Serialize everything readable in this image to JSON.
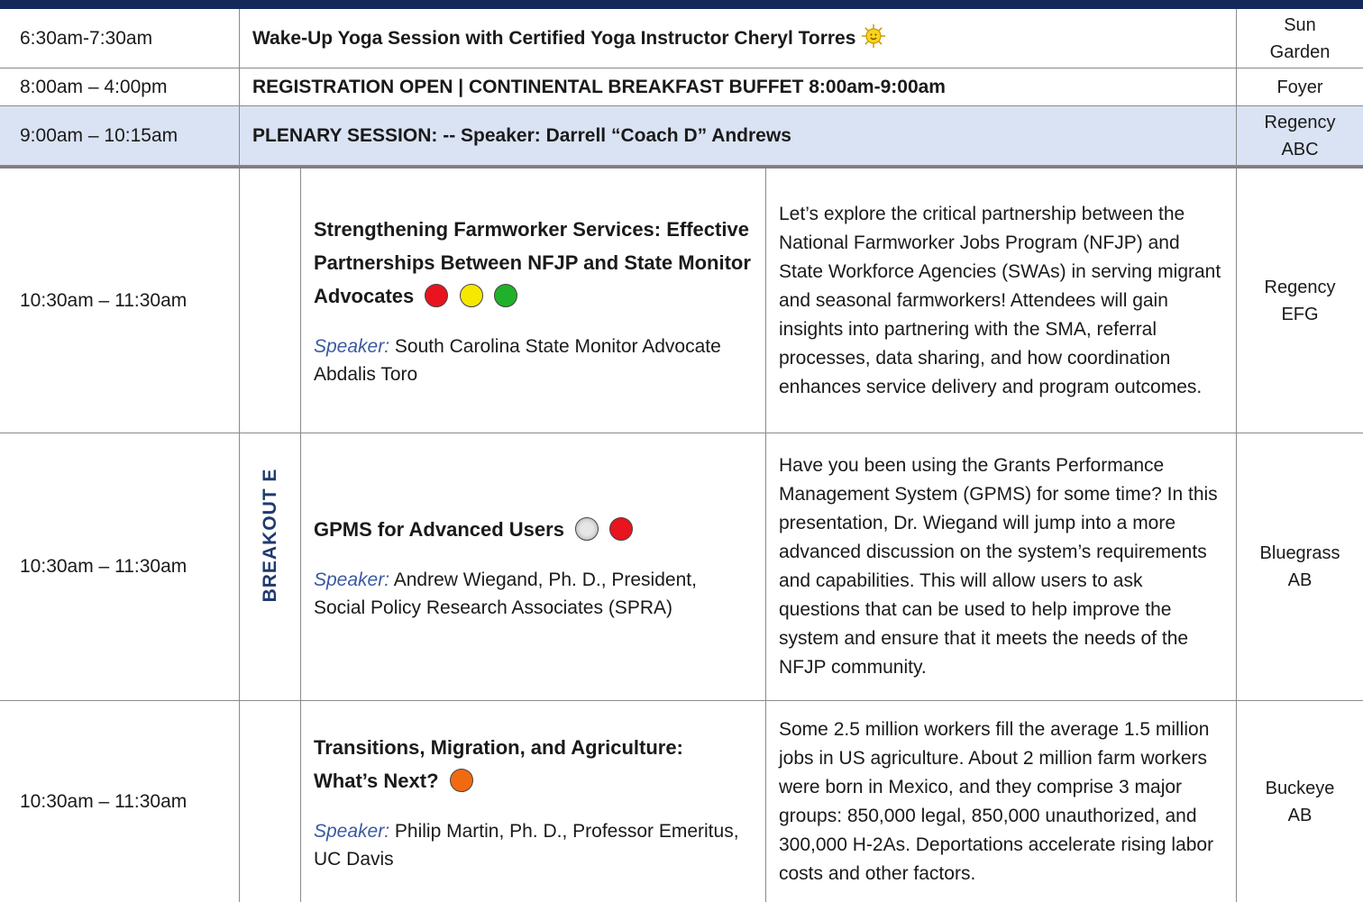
{
  "rows_top": [
    {
      "time": "6:30am-7:30am",
      "title": "Wake-Up Yoga Session with Certified Yoga Instructor Cheryl Torres",
      "icon": "sun-icon",
      "room_line1": "Sun",
      "room_line2": "Garden"
    },
    {
      "time": "8:00am – 4:00pm",
      "title": "REGISTRATION OPEN | CONTINENTAL BREAKFAST BUFFET 8:00am-9:00am",
      "room_line1": "Foyer",
      "room_line2": ""
    },
    {
      "time": "9:00am – 10:15am",
      "title": "PLENARY SESSION:  -- Speaker:  Darrell “Coach D” Andrews",
      "room_line1": "Regency",
      "room_line2": "ABC",
      "highlight": "#dae3f3"
    }
  ],
  "breakout_label": "BREAKOUT E",
  "sessions": [
    {
      "time": "10:30am – 11:30am",
      "title": "Strengthening Farmworker Services: Effective Partnerships Between NFJP and State Monitor Advocates",
      "level_dots": [
        "#e8141e",
        "#f6e800",
        "#21b02a"
      ],
      "speaker_label": "Speaker:",
      "speaker": "South Carolina State Monitor Advocate Abdalis Toro",
      "description": "Let’s explore the critical partnership between the National Farmworker Jobs Program (NFJP) and State Workforce Agencies (SWAs) in serving migrant and seasonal farmworkers!  Attendees will gain insights into partnering with the SMA, referral processes, data sharing, and how coordination enhances service delivery and program outcomes.",
      "room_line1": "Regency",
      "room_line2": "EFG"
    },
    {
      "time": "10:30am – 11:30am",
      "title": "GPMS for Advanced Users",
      "level_dots": [
        "#c8c8c8",
        "#e8141e"
      ],
      "speaker_label": "Speaker:",
      "speaker": " Andrew Wiegand, Ph. D., President, Social Policy Research Associates (SPRA)",
      "description": "Have you been using the Grants Performance Management System (GPMS) for some time? In this presentation, Dr. Wiegand will jump into a more advanced discussion on the system’s requirements and capabilities. This will allow users to ask questions that can be used to help improve the system and ensure that it meets the needs of the NFJP community.",
      "room_line1": "Bluegrass",
      "room_line2": "AB"
    },
    {
      "time": "10:30am – 11:30am",
      "title": "Transitions, Migration, and Agriculture: What’s Next?",
      "level_dots": [
        "#f26a10"
      ],
      "speaker_label": "Speaker:",
      "speaker": "Philip Martin, Ph. D., Professor Emeritus, UC Davis",
      "description": "Some 2.5 million workers fill the average 1.5 million jobs in US agriculture. About 2 million farm workers were born in Mexico, and they comprise 3 major groups: 850,000 legal, 850,000 unauthorized, and 300,000 H-2As. Deportations accelerate rising labor costs and other factors.",
      "room_line1": "Buckeye",
      "room_line2": "AB"
    }
  ],
  "colors": {
    "header_bar": "#15285a",
    "breakout_text": "#1f3a6e",
    "speaker_label": "#3b5aa0"
  }
}
